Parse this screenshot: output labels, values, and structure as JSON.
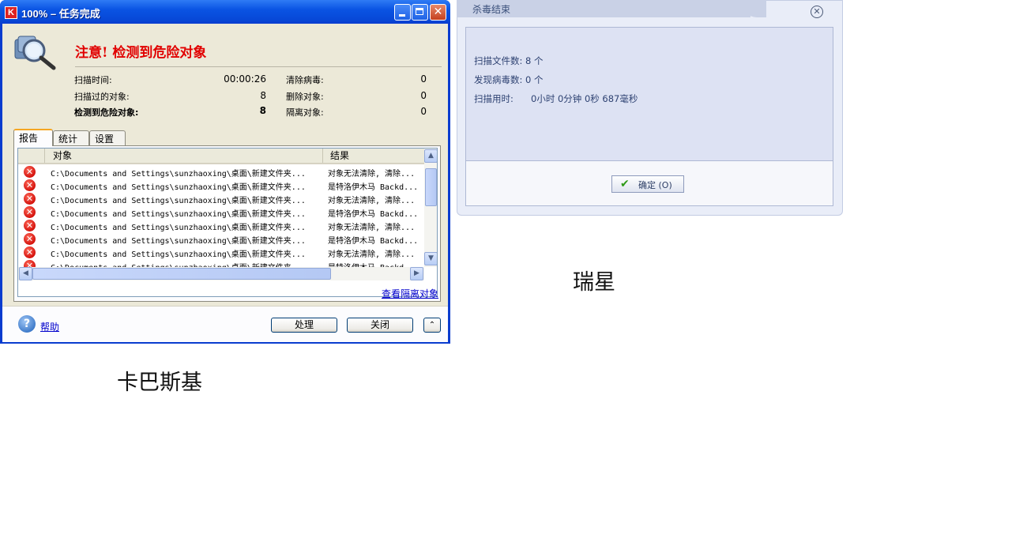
{
  "kaspersky": {
    "window_title": "100% – 任务完成",
    "warning": "注意! 检测到危险对象",
    "stats": {
      "scan_time_label": "扫描时间:",
      "scan_time": "00:00:26",
      "scanned_label": "扫描过的对象:",
      "scanned": "8",
      "detected_label": "检测到危险对象:",
      "detected": "8",
      "cleaned_label": "清除病毒:",
      "cleaned": "0",
      "deleted_label": "删除对象:",
      "deleted": "0",
      "quarantined_label": "隔离对象:",
      "quarantined": "0"
    },
    "tabs": [
      "报告",
      "统计",
      "设置"
    ],
    "columns": [
      "对象",
      "结果"
    ],
    "rows": [
      {
        "object": "C:\\Documents and Settings\\sunzhaoxing\\桌面\\新建文件夹...",
        "result": "对象无法清除, 清除..."
      },
      {
        "object": "C:\\Documents and Settings\\sunzhaoxing\\桌面\\新建文件夹...",
        "result": "是特洛伊木马 Backd..."
      },
      {
        "object": "C:\\Documents and Settings\\sunzhaoxing\\桌面\\新建文件夹...",
        "result": "对象无法清除, 清除..."
      },
      {
        "object": "C:\\Documents and Settings\\sunzhaoxing\\桌面\\新建文件夹...",
        "result": "是特洛伊木马 Backd..."
      },
      {
        "object": "C:\\Documents and Settings\\sunzhaoxing\\桌面\\新建文件夹...",
        "result": "对象无法清除, 清除..."
      },
      {
        "object": "C:\\Documents and Settings\\sunzhaoxing\\桌面\\新建文件夹...",
        "result": "是特洛伊木马 Backd..."
      },
      {
        "object": "C:\\Documents and Settings\\sunzhaoxing\\桌面\\新建文件夹...",
        "result": "对象无法清除, 清除..."
      },
      {
        "object": "C:\\Documents and Settings\\sunzhaoxing\\桌面\\新建文件夹...",
        "result": "是特洛伊木马 Backd..."
      }
    ],
    "quarantine_link": "查看隔离对象",
    "help_link": "帮助",
    "process_button": "处理",
    "close_button": "关闭"
  },
  "rising": {
    "title": "杀毒结束",
    "files_scanned": "扫描文件数:  8 个",
    "viruses_found": "发现病毒数:  0 个",
    "time_used_label": "扫描用时:",
    "time_used": "0小时  0分钟  0秒  687毫秒",
    "ok_button": "确定 (O)"
  },
  "captions": {
    "rising": "瑞星",
    "kaspersky": "卡巴斯基"
  },
  "colors": {
    "xp_title_blue": "#0a54e3",
    "warning_red": "#e10000",
    "dialog_beige": "#ece9d8",
    "rising_panel": "#dde2f3"
  }
}
